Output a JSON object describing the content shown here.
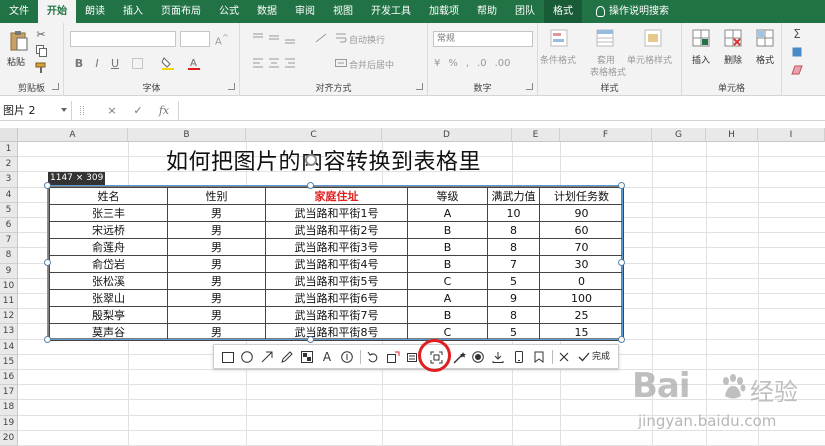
{
  "tabs": [
    "文件",
    "开始",
    "朗读",
    "插入",
    "页面布局",
    "公式",
    "数据",
    "审阅",
    "视图",
    "开发工具",
    "加载项",
    "帮助",
    "团队",
    "格式"
  ],
  "active_tab": "开始",
  "tell_me": "操作说明搜索",
  "ribbon": {
    "clipboard": {
      "paste": "粘贴",
      "label": "剪贴板"
    },
    "font": {
      "label": "字体",
      "bold": "B",
      "italic": "I",
      "underline": "U"
    },
    "alignment": {
      "wrap": "自动换行",
      "merge": "合并后居中",
      "label": "对齐方式"
    },
    "number": {
      "format": "常规",
      "label": "数字"
    },
    "styles": {
      "conditional": "条件格式",
      "table_format_1": "套用",
      "table_format_2": "表格格式",
      "cell_styles": "单元格样式",
      "label": "样式"
    },
    "cells": {
      "insert": "插入",
      "delete": "删除",
      "format": "格式",
      "label": "单元格"
    }
  },
  "formula_bar": {
    "name_box": "图片 2",
    "cancel": "×",
    "enter": "✓",
    "fx": "fx",
    "value": ""
  },
  "columns": [
    "A",
    "B",
    "C",
    "D",
    "E",
    "F",
    "G",
    "H",
    "I"
  ],
  "rows": [
    "1",
    "2",
    "3",
    "4",
    "5",
    "6",
    "7",
    "8",
    "9",
    "10",
    "11",
    "12",
    "13",
    "14",
    "15",
    "16",
    "17",
    "18",
    "19",
    "20"
  ],
  "sheet_title": "如何把图片的内容转换到表格里",
  "picture": {
    "size_tag": "1147 × 309",
    "headers": [
      "姓名",
      "性别",
      "家庭住址",
      "等级",
      "满武力值",
      "计划任务数"
    ],
    "rows": [
      [
        "张三丰",
        "男",
        "武当路和平街1号",
        "A",
        "10",
        "90"
      ],
      [
        "宋远桥",
        "男",
        "武当路和平街2号",
        "B",
        "8",
        "60"
      ],
      [
        "俞莲舟",
        "男",
        "武当路和平街3号",
        "B",
        "8",
        "70"
      ],
      [
        "俞岱岩",
        "男",
        "武当路和平街4号",
        "B",
        "7",
        "30"
      ],
      [
        "张松溪",
        "男",
        "武当路和平街5号",
        "C",
        "5",
        "0"
      ],
      [
        "张翠山",
        "男",
        "武当路和平街6号",
        "A",
        "9",
        "100"
      ],
      [
        "殷梨亭",
        "男",
        "武当路和平街7号",
        "B",
        "8",
        "25"
      ],
      [
        "莫声谷",
        "男",
        "武当路和平街8号",
        "C",
        "5",
        "15"
      ]
    ]
  },
  "snip_toolbar": {
    "done": "完成",
    "text_tool": "A"
  },
  "watermark": {
    "brand": "Bai",
    "brand_cn": "经验",
    "url": "jingyan.baidu.com"
  },
  "colors": {
    "excel_green": "#217346",
    "header_red": "#e02020",
    "selection_blue": "#5b9bd5"
  }
}
